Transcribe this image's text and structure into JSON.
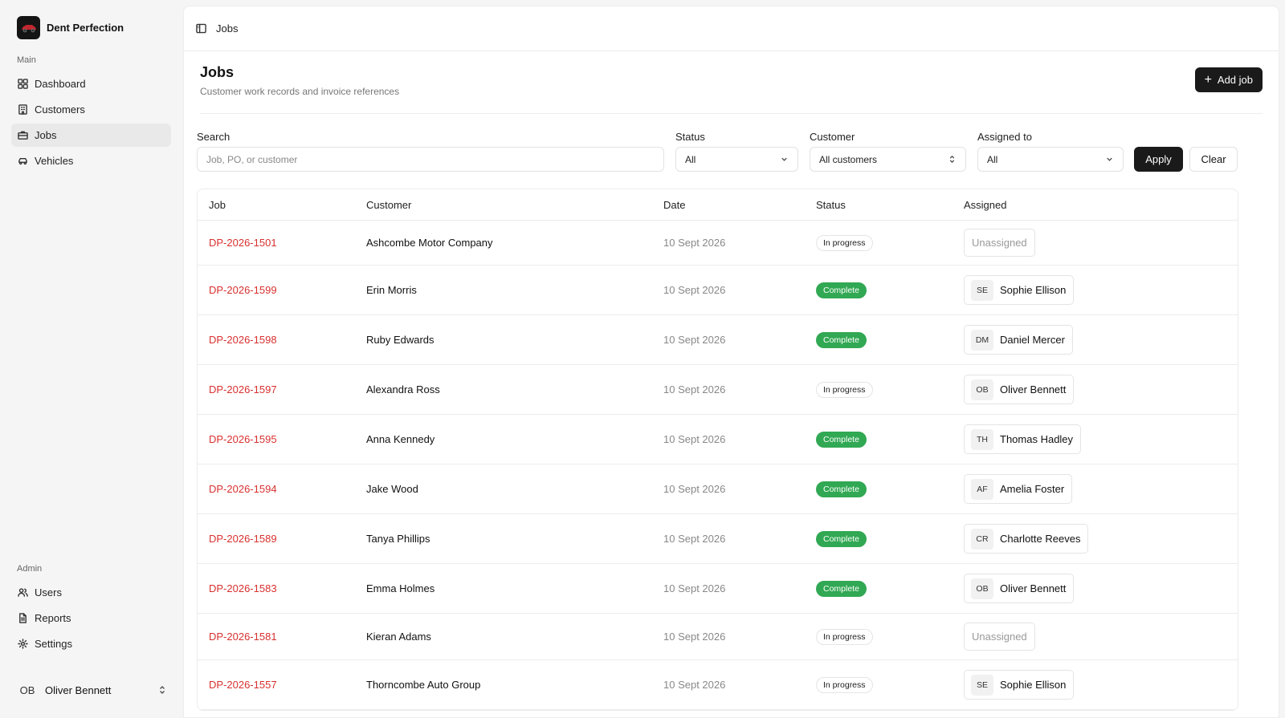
{
  "brand": {
    "name": "Dent Perfection",
    "logo_icon": "car-logo-icon"
  },
  "sidebar": {
    "main_label": "Main",
    "main_items": [
      {
        "label": "Dashboard",
        "icon": "dashboard-icon"
      },
      {
        "label": "Customers",
        "icon": "building-icon"
      },
      {
        "label": "Jobs",
        "icon": "briefcase-icon",
        "active": true
      },
      {
        "label": "Vehicles",
        "icon": "car-icon"
      }
    ],
    "admin_label": "Admin",
    "admin_items": [
      {
        "label": "Users",
        "icon": "users-icon"
      },
      {
        "label": "Reports",
        "icon": "file-icon"
      },
      {
        "label": "Settings",
        "icon": "gear-icon"
      }
    ],
    "user": {
      "initials": "OB",
      "name": "Oliver Bennett"
    }
  },
  "topbar": {
    "title": "Jobs"
  },
  "page": {
    "title": "Jobs",
    "subtitle": "Customer work records and invoice references",
    "add_button": "Add job"
  },
  "filters": {
    "search": {
      "label": "Search",
      "placeholder": "Job, PO, or customer",
      "value": ""
    },
    "status": {
      "label": "Status",
      "value": "All"
    },
    "customer": {
      "label": "Customer",
      "value": "All customers"
    },
    "assigned": {
      "label": "Assigned to",
      "value": "All"
    },
    "apply_label": "Apply",
    "clear_label": "Clear"
  },
  "table": {
    "headers": {
      "job": "Job",
      "customer": "Customer",
      "date": "Date",
      "status": "Status",
      "assigned": "Assigned"
    },
    "rows": [
      {
        "job": "DP-2026-1501",
        "customer": "Ashcombe Motor Company",
        "date": "10 Sept 2026",
        "status": "In progress",
        "status_type": "progress",
        "assigned": null,
        "assigned_label": "Unassigned"
      },
      {
        "job": "DP-2026-1599",
        "customer": "Erin Morris",
        "date": "10 Sept 2026",
        "status": "Complete",
        "status_type": "complete",
        "assigned": {
          "initials": "SE",
          "name": "Sophie Ellison"
        }
      },
      {
        "job": "DP-2026-1598",
        "customer": "Ruby Edwards",
        "date": "10 Sept 2026",
        "status": "Complete",
        "status_type": "complete",
        "assigned": {
          "initials": "DM",
          "name": "Daniel Mercer"
        }
      },
      {
        "job": "DP-2026-1597",
        "customer": "Alexandra Ross",
        "date": "10 Sept 2026",
        "status": "In progress",
        "status_type": "progress",
        "assigned": {
          "initials": "OB",
          "name": "Oliver Bennett"
        }
      },
      {
        "job": "DP-2026-1595",
        "customer": "Anna Kennedy",
        "date": "10 Sept 2026",
        "status": "Complete",
        "status_type": "complete",
        "assigned": {
          "initials": "TH",
          "name": "Thomas Hadley"
        }
      },
      {
        "job": "DP-2026-1594",
        "customer": "Jake Wood",
        "date": "10 Sept 2026",
        "status": "Complete",
        "status_type": "complete",
        "assigned": {
          "initials": "AF",
          "name": "Amelia Foster"
        }
      },
      {
        "job": "DP-2026-1589",
        "customer": "Tanya Phillips",
        "date": "10 Sept 2026",
        "status": "Complete",
        "status_type": "complete",
        "assigned": {
          "initials": "CR",
          "name": "Charlotte Reeves"
        }
      },
      {
        "job": "DP-2026-1583",
        "customer": "Emma Holmes",
        "date": "10 Sept 2026",
        "status": "Complete",
        "status_type": "complete",
        "assigned": {
          "initials": "OB",
          "name": "Oliver Bennett"
        }
      },
      {
        "job": "DP-2026-1581",
        "customer": "Kieran Adams",
        "date": "10 Sept 2026",
        "status": "In progress",
        "status_type": "progress",
        "assigned": null,
        "assigned_label": "Unassigned"
      },
      {
        "job": "DP-2026-1557",
        "customer": "Thorncombe Auto Group",
        "date": "10 Sept 2026",
        "status": "In progress",
        "status_type": "progress",
        "assigned": {
          "initials": "SE",
          "name": "Sophie Ellison"
        }
      }
    ]
  },
  "colors": {
    "accent": "#1a1a1a",
    "job_link": "#d8302f",
    "complete": "#31a853"
  }
}
